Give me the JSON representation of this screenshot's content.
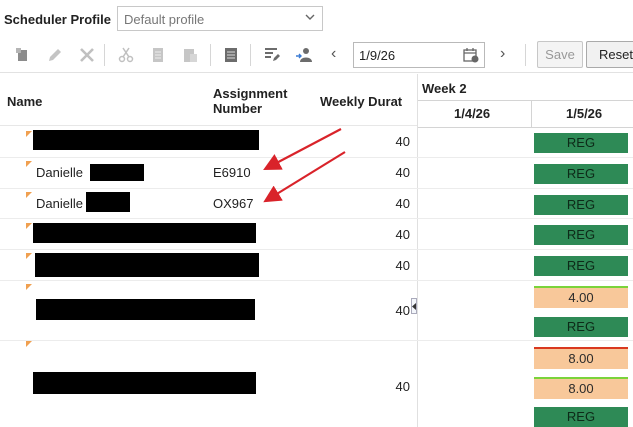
{
  "header": {
    "profile_label": "Scheduler Profile",
    "profile_value": "Default profile"
  },
  "toolbar": {
    "date_value": "1/9/26",
    "save_label": "Save",
    "reset_label": "Reset"
  },
  "columns": {
    "name": "Name",
    "assignment_line1": "Assignment",
    "assignment_line2": "Number",
    "weekly_duration": "Weekly Durat",
    "week_label": "Week 2",
    "date1": "1/4/26",
    "date2": "1/5/26"
  },
  "rows": [
    {
      "name": "",
      "assignment": "",
      "duration": "40",
      "cells": [
        "REG"
      ]
    },
    {
      "name": "Danielle",
      "assignment": "E6910",
      "duration": "40",
      "cells": [
        "REG"
      ]
    },
    {
      "name": "Danielle",
      "assignment": "OX967",
      "duration": "40",
      "cells": [
        "REG"
      ]
    },
    {
      "name": "",
      "assignment": "",
      "duration": "40",
      "cells": [
        "REG"
      ]
    },
    {
      "name": "",
      "assignment": "",
      "duration": "40",
      "cells": [
        "REG"
      ]
    },
    {
      "name": "",
      "assignment": "",
      "duration": "40",
      "cells": [
        "4.00",
        "REG"
      ]
    },
    {
      "name": "",
      "assignment": "",
      "duration": "40",
      "cells": [
        "8.00",
        "8.00",
        "REG"
      ]
    }
  ],
  "colors": {
    "reg": "#2e8a56",
    "hours": "#f8c89a",
    "annotation_arrow": "#d9232a"
  }
}
